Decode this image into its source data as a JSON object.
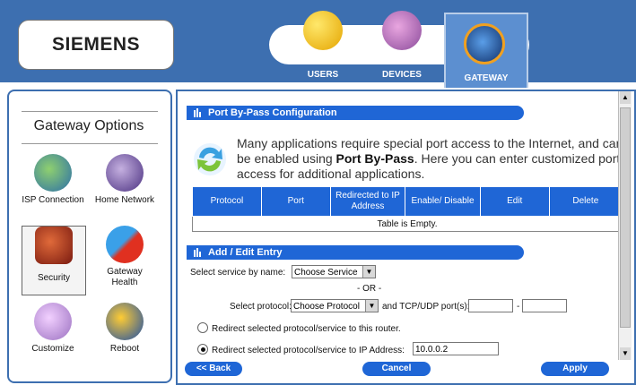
{
  "header": {
    "logo": "SIEMENS",
    "tabs": [
      {
        "label": "USERS",
        "icon": "users-icon"
      },
      {
        "label": "DEVICES",
        "icon": "devices-icon"
      },
      {
        "label": "GATEWAY",
        "icon": "gateway-icon"
      }
    ]
  },
  "sidebar": {
    "title": "Gateway Options",
    "options": [
      {
        "label": "ISP Connection",
        "icon": "isp-connection-icon"
      },
      {
        "label": "Home Network",
        "icon": "home-network-icon"
      },
      {
        "label": "Security",
        "icon": "security-lock-icon"
      },
      {
        "label": "Gateway Health",
        "icon": "thermometer-icon"
      },
      {
        "label": "Customize",
        "icon": "palette-icon"
      },
      {
        "label": "Reboot",
        "icon": "reboot-icon"
      }
    ]
  },
  "main": {
    "section1_title": "Port By-Pass Configuration",
    "intro_text_1": "Many applications require special port access to the Internet, and can be enabled using ",
    "intro_bold": "Port By-Pass",
    "intro_text_2": ". Here you can enter customized port access for additional applications.",
    "table": {
      "columns": [
        "Protocol",
        "Port",
        "Redirected to IP Address",
        "Enable/ Disable",
        "Edit",
        "Delete"
      ],
      "empty_message": "Table is Empty."
    },
    "section2_title": "Add / Edit Entry",
    "service_label": "Select service by name:",
    "service_value": "Choose Service",
    "or_text": "- OR -",
    "protocol_label": "Select protocol:",
    "protocol_value": "Choose Protocol",
    "ports_label": "and TCP/UDP port(s):",
    "port_dash": "-",
    "port_from": "",
    "port_to": "",
    "radio_router": "Redirect selected protocol/service to this router.",
    "radio_ip": "Redirect selected protocol/service to IP Address:",
    "ip_value": "10.0.0.2"
  },
  "footer": {
    "back": "<< Back",
    "cancel": "Cancel",
    "apply": "Apply"
  },
  "colors": {
    "header_blue": "#3d6fb0",
    "bar_blue": "#1f66d6"
  }
}
